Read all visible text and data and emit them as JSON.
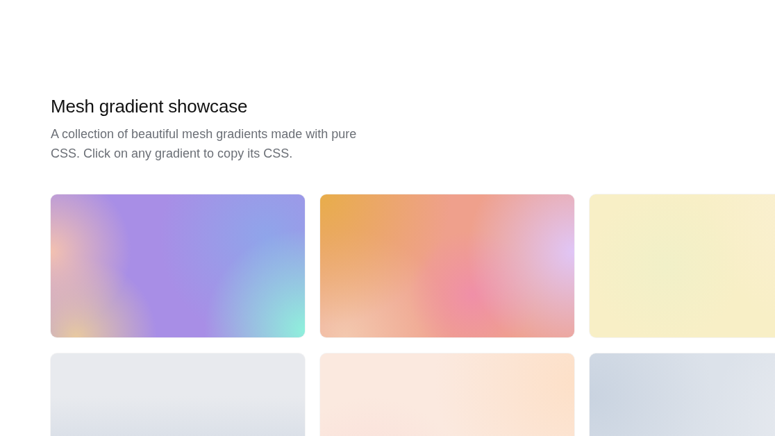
{
  "title": "Mesh gradient showcase",
  "description": "A collection of beautiful mesh gradients made with pure CSS. Click on any gradient to copy its CSS.",
  "gradients": [
    {
      "color": "#a88ee6"
    },
    {
      "color": "#efa08c"
    },
    {
      "color": "#f8efc6"
    },
    {
      "color": "#e2e6ed"
    },
    {
      "color": "#fbe9df"
    },
    {
      "color": "#dce2ea"
    }
  ]
}
